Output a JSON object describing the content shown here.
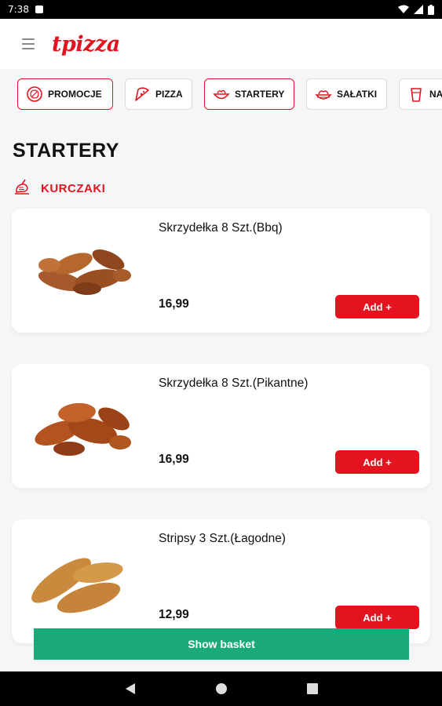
{
  "status_bar": {
    "time": "7:38",
    "icons": [
      "notification-icon",
      "wifi-icon",
      "signal-icon",
      "battery-icon"
    ]
  },
  "app_bar": {
    "menu_icon": "hamburger-icon",
    "logo_text": "tpizza",
    "brand_color": "#e3141f"
  },
  "categories": [
    {
      "label": "PROMOCJE",
      "icon": "promo-icon",
      "active": true
    },
    {
      "label": "PIZZA",
      "icon": "pizza-slice-icon",
      "active": false
    },
    {
      "label": "STARTERY",
      "icon": "starter-bowl-icon",
      "active": true
    },
    {
      "label": "SAŁATKI",
      "icon": "salad-bowl-icon",
      "active": false
    },
    {
      "label": "NA",
      "icon": "drink-cup-icon",
      "active": false
    }
  ],
  "section": {
    "title": "STARTERY",
    "subcategory": {
      "label": "KURCZAKI",
      "icon": "chicken-drumstick-icon"
    }
  },
  "products": [
    {
      "name": "Skrzydełka 8 Szt.(Bbq)",
      "price": "16,99",
      "add_label": "Add +",
      "image": "chicken-wings-bbq-image"
    },
    {
      "name": "Skrzydełka 8 Szt.(Pikantne)",
      "price": "16,99",
      "add_label": "Add +",
      "image": "chicken-wings-spicy-image"
    },
    {
      "name": "Stripsy 3 Szt.(Łagodne)",
      "price": "12,99",
      "add_label": "Add +",
      "image": "chicken-strips-image"
    }
  ],
  "basket_button": {
    "label": "Show basket",
    "color": "#1aa97a"
  },
  "nav_bar": {
    "icons": [
      "back-icon",
      "home-icon",
      "recents-icon"
    ]
  }
}
